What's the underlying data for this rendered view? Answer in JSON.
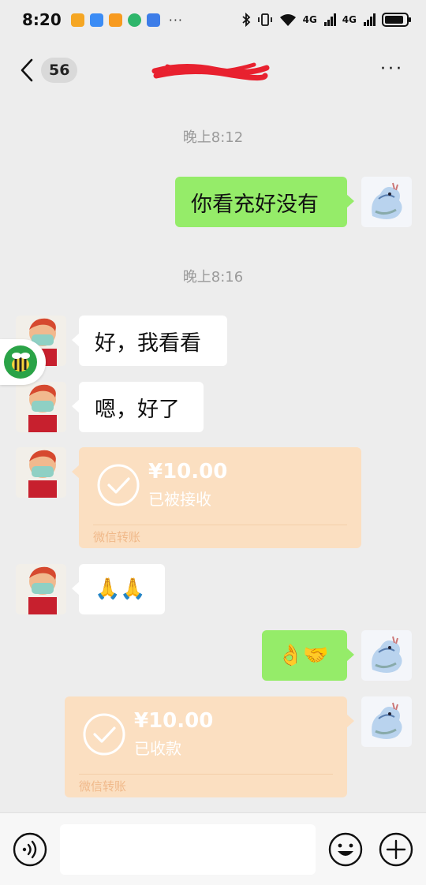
{
  "status_bar": {
    "time": "8:20",
    "more": "···",
    "network_1": "4G",
    "network_2": "4G",
    "battery_level": 0.9
  },
  "nav": {
    "unread_count": "56",
    "title": "",
    "more_label": "···"
  },
  "messages": {
    "time_1": "晚上8:12",
    "m1_text": "你看充好没有",
    "time_2": "晚上8:16",
    "m2_text": "好，我看看",
    "m3_text": "嗯，好了",
    "m4_amount": "¥10.00",
    "m4_status": "已被接收",
    "m4_footer": "微信转账",
    "m5_text": "🙏🙏",
    "m6_text": "👌🤝",
    "m7_amount": "¥10.00",
    "m7_status": "已收款",
    "m7_footer": "微信转账"
  },
  "input": {
    "value": ""
  },
  "icons": {
    "back": "chevron-left-icon",
    "more": "more-dots-icon",
    "voice": "voice-icon",
    "emoji": "emoji-icon",
    "plus": "plus-icon"
  },
  "colors": {
    "green_bubble": "#95ec69",
    "white_bubble": "#ffffff",
    "transfer_bg": "#fbdfc1",
    "background": "#ededed",
    "redaction": "#e8212f"
  }
}
